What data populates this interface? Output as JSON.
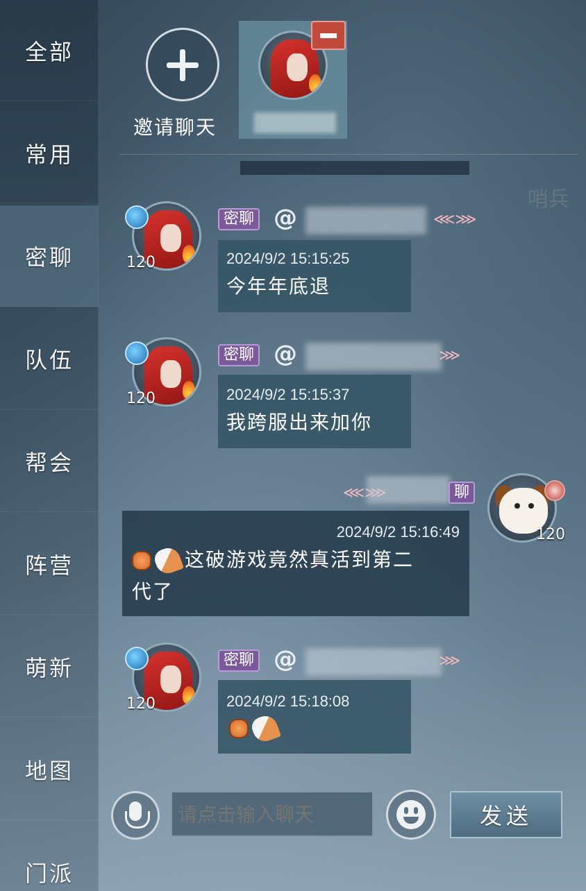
{
  "sidebar": {
    "tabs": [
      {
        "label": "全部"
      },
      {
        "label": "常用"
      },
      {
        "label": "密聊"
      },
      {
        "label": "队伍"
      },
      {
        "label": "帮会"
      },
      {
        "label": "阵营"
      },
      {
        "label": "萌新"
      },
      {
        "label": "地图"
      },
      {
        "label": "门派"
      }
    ],
    "active": "密聊"
  },
  "members": {
    "invite_label": "邀请聊天"
  },
  "messages": [
    {
      "tag": "密聊",
      "level": "120",
      "timestamp": "2024/9/2 15:15:25",
      "text": "今年年底退",
      "side": "left"
    },
    {
      "tag": "密聊",
      "level": "120",
      "timestamp": "2024/9/2 15:15:37",
      "text": "我跨服出来加你",
      "side": "left"
    },
    {
      "tag": "聊",
      "level": "120",
      "timestamp": "2024/9/2 15:16:49",
      "text_line1": "这破游戏竟然真活到第二",
      "text_line2": "代了",
      "side": "right"
    },
    {
      "tag": "密聊",
      "level": "120",
      "timestamp": "2024/9/2 15:18:08",
      "text": "",
      "side": "left"
    }
  ],
  "input": {
    "placeholder": "请点击输入聊天",
    "send_label": "发送"
  },
  "colors": {
    "tag_purple": "#7a5a98",
    "remove_red": "#c24a3d",
    "bubble": "#345464"
  }
}
